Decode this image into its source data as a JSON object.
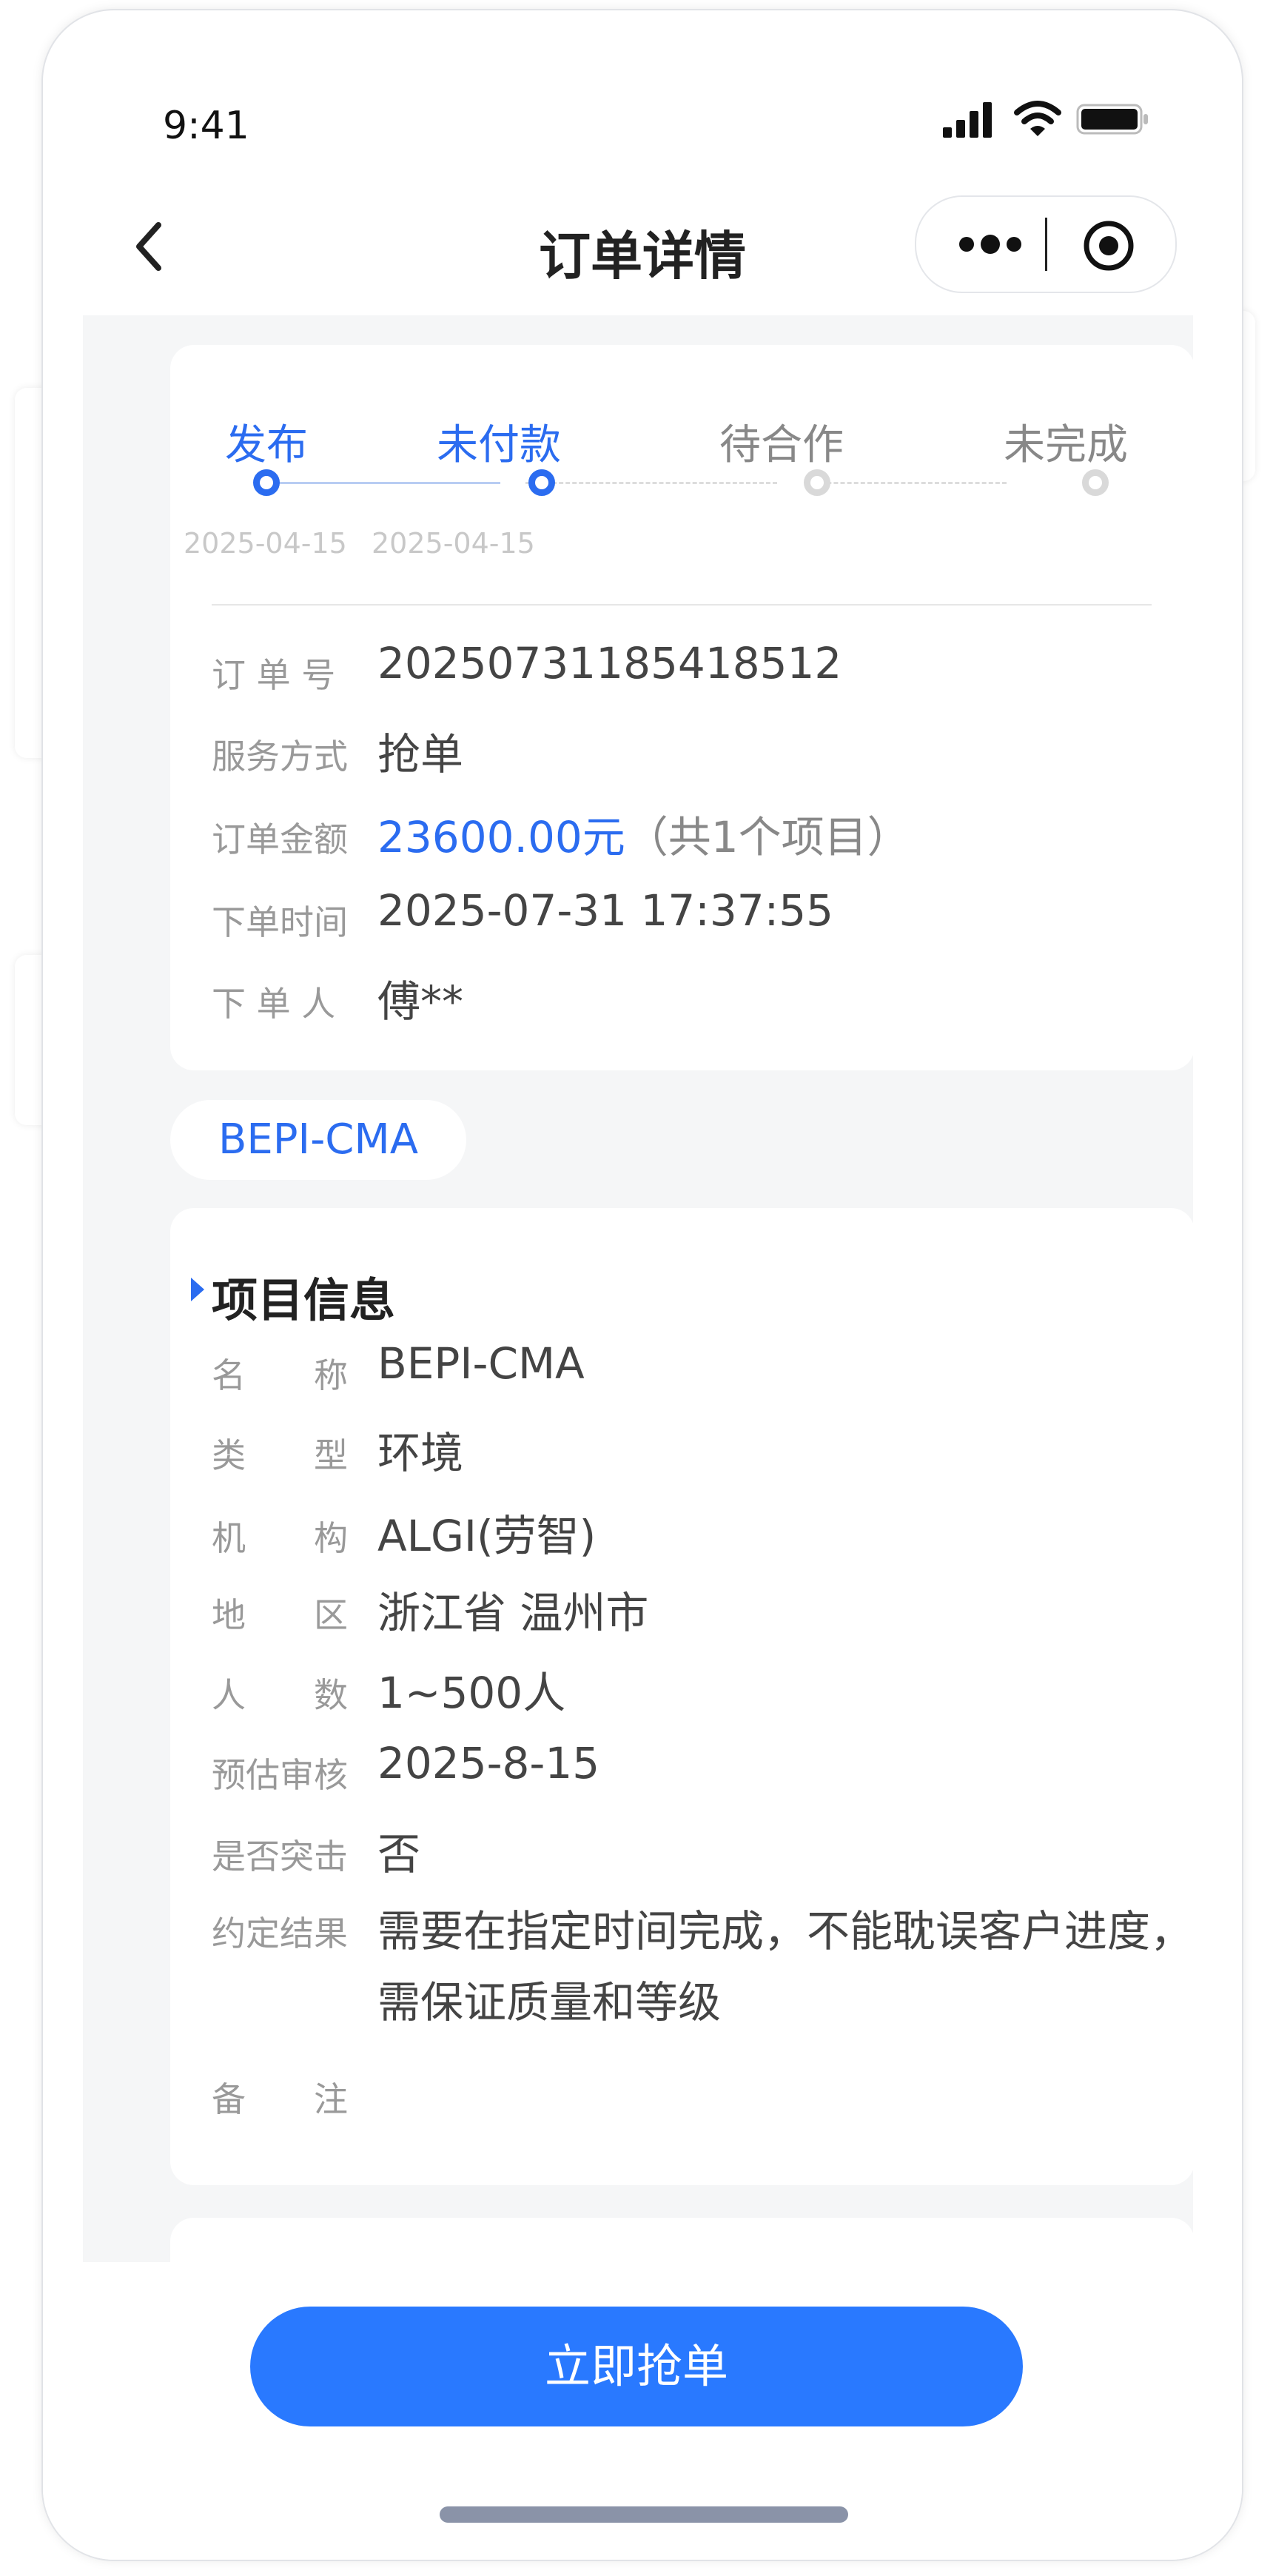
{
  "status_bar": {
    "time": "9:41"
  },
  "nav": {
    "title": "订单详情",
    "back_icon": "chevron-left-icon",
    "more_icon": "more-dots-icon",
    "target_icon": "target-icon"
  },
  "steps": [
    {
      "label": "发布",
      "date": "2025-04-15",
      "state": "done"
    },
    {
      "label": "未付款",
      "date": "2025-04-15",
      "state": "current"
    },
    {
      "label": "待合作",
      "date": "",
      "state": "todo"
    },
    {
      "label": "未完成",
      "date": "",
      "state": "todo"
    }
  ],
  "order": {
    "number_label": "订 单 号",
    "number": "20250731185418512",
    "service_label": "服务方式",
    "service": "抢单",
    "amount_label": "订单金额",
    "amount": "23600.00元",
    "amount_note": "（共1个项目）",
    "time_label": "下单时间",
    "time": "2025-07-31 17:37:55",
    "user_label": "下 单 人",
    "user": "傅**"
  },
  "project_tag": "BEPI-CMA",
  "project": {
    "title": "项目信息",
    "rows": [
      {
        "label": "名　　称",
        "value": "BEPI-CMA"
      },
      {
        "label": "类　　型",
        "value": "环境"
      },
      {
        "label": "机　　构",
        "value": "ALGI(劳智)"
      },
      {
        "label": "地　　区",
        "value": "浙江省 温州市"
      },
      {
        "label": "人　　数",
        "value": "1~500人"
      },
      {
        "label": "预估审核",
        "value": "2025-8-15"
      },
      {
        "label": "是否突击",
        "value": "否"
      },
      {
        "label": "约定结果",
        "value": "需要在指定时间完成，不能耽误客户进度，",
        "value2": "需保证质量和等级"
      },
      {
        "label": "备　　注",
        "value": ""
      }
    ]
  },
  "footer": {
    "cta": "立即抢单"
  },
  "colors": {
    "accent": "#2b6cf0",
    "button": "#2979ff",
    "background": "#f5f6f7"
  }
}
